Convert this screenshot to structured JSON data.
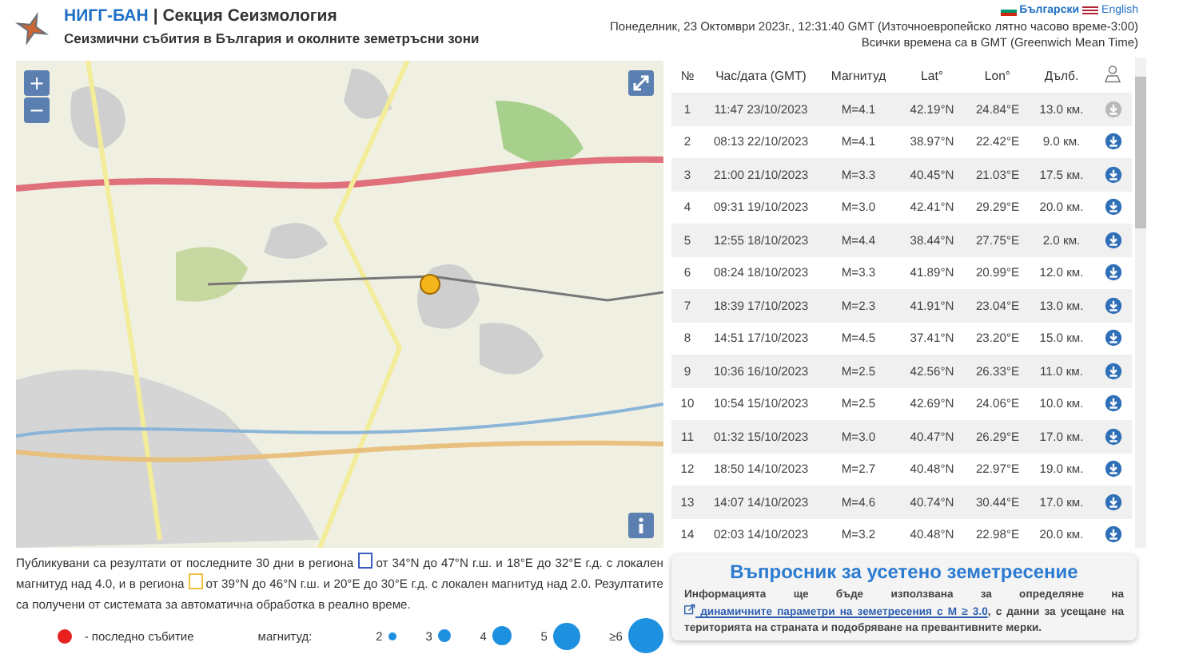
{
  "header": {
    "brand": "НИГГ-БАН",
    "section": "| Секция Сеизмология",
    "subtitle": "Сеизмични събития в България и околните земетръсни зони",
    "languages": [
      {
        "label": "Български",
        "selected": true
      },
      {
        "label": "English",
        "selected": false
      }
    ],
    "datetime": "Понеделник, 23 Октомври 2023г., 12:31:40 GMT (Източноевропейско лятно часово време-3:00)",
    "timezone_note": "Всички времена са в GMT (Greenwich Mean Time)"
  },
  "map": {
    "zoom_in": "+",
    "zoom_out": "−"
  },
  "table": {
    "columns": [
      "№",
      "Час/дата (GMT)",
      "Магнитуд",
      "Lat°",
      "Lon°",
      "Дълб."
    ],
    "rows": [
      {
        "no": "1",
        "time": "11:47 23/10/2023",
        "mag": "M=4.1",
        "lat": "42.19°N",
        "lon": "24.84°E",
        "depth": "13.0 км.",
        "download_available": false
      },
      {
        "no": "2",
        "time": "08:13 22/10/2023",
        "mag": "M=4.1",
        "lat": "38.97°N",
        "lon": "22.42°E",
        "depth": "9.0 км.",
        "download_available": true
      },
      {
        "no": "3",
        "time": "21:00 21/10/2023",
        "mag": "M=3.3",
        "lat": "40.45°N",
        "lon": "21.03°E",
        "depth": "17.5 км.",
        "download_available": true
      },
      {
        "no": "4",
        "time": "09:31 19/10/2023",
        "mag": "M=3.0",
        "lat": "42.41°N",
        "lon": "29.29°E",
        "depth": "20.0 км.",
        "download_available": true
      },
      {
        "no": "5",
        "time": "12:55 18/10/2023",
        "mag": "M=4.4",
        "lat": "38.44°N",
        "lon": "27.75°E",
        "depth": "2.0 км.",
        "download_available": true
      },
      {
        "no": "6",
        "time": "08:24 18/10/2023",
        "mag": "M=3.3",
        "lat": "41.89°N",
        "lon": "20.99°E",
        "depth": "12.0 км.",
        "download_available": true
      },
      {
        "no": "7",
        "time": "18:39 17/10/2023",
        "mag": "M=2.3",
        "lat": "41.91°N",
        "lon": "23.04°E",
        "depth": "13.0 км.",
        "download_available": true
      },
      {
        "no": "8",
        "time": "14:51 17/10/2023",
        "mag": "M=4.5",
        "lat": "37.41°N",
        "lon": "23.20°E",
        "depth": "15.0 км.",
        "download_available": true
      },
      {
        "no": "9",
        "time": "10:36 16/10/2023",
        "mag": "M=2.5",
        "lat": "42.56°N",
        "lon": "26.33°E",
        "depth": "11.0 км.",
        "download_available": true
      },
      {
        "no": "10",
        "time": "10:54 15/10/2023",
        "mag": "M=2.5",
        "lat": "42.69°N",
        "lon": "24.06°E",
        "depth": "10.0 км.",
        "download_available": true
      },
      {
        "no": "11",
        "time": "01:32 15/10/2023",
        "mag": "M=3.0",
        "lat": "40.47°N",
        "lon": "26.29°E",
        "depth": "17.0 км.",
        "download_available": true
      },
      {
        "no": "12",
        "time": "18:50 14/10/2023",
        "mag": "M=2.7",
        "lat": "40.48°N",
        "lon": "22.97°E",
        "depth": "19.0 км.",
        "download_available": true
      },
      {
        "no": "13",
        "time": "14:07 14/10/2023",
        "mag": "M=4.6",
        "lat": "40.74°N",
        "lon": "30.44°E",
        "depth": "17.0 км.",
        "download_available": true
      },
      {
        "no": "14",
        "time": "02:03 14/10/2023",
        "mag": "M=3.2",
        "lat": "40.48°N",
        "lon": "22.98°E",
        "depth": "20.0 км.",
        "download_available": true
      }
    ]
  },
  "description": {
    "part_1": "Публикувани са резултати от последните 30 дни в региона",
    "part_2": "от 34°N до 47°N г.ш. и 18°E до 32°E г.д. с локален магнитуд над 4.0, и в региона",
    "part_3": "от 39°N до 46°N г.ш. и 20°E до 30°E г.д. с локален магнитуд над 2.0. Резултатите са получени от системата за автоматична обработка в реално време."
  },
  "legend": {
    "latest_label": "- последно събитие",
    "magnitude_label": "магнитуд:",
    "sizes": [
      "2",
      "3",
      "4",
      "5",
      "≥6"
    ]
  },
  "questionnaire": {
    "title": "Въпросник за усетено земетресение",
    "text_before": "Информацията ще бъде използвана за определяне на",
    "link": "динамичните параметри на земетресения с M ≥ 3.0",
    "text_after": ", с данни за усещане на територията на страната и подобряване на превантивните мерки."
  }
}
